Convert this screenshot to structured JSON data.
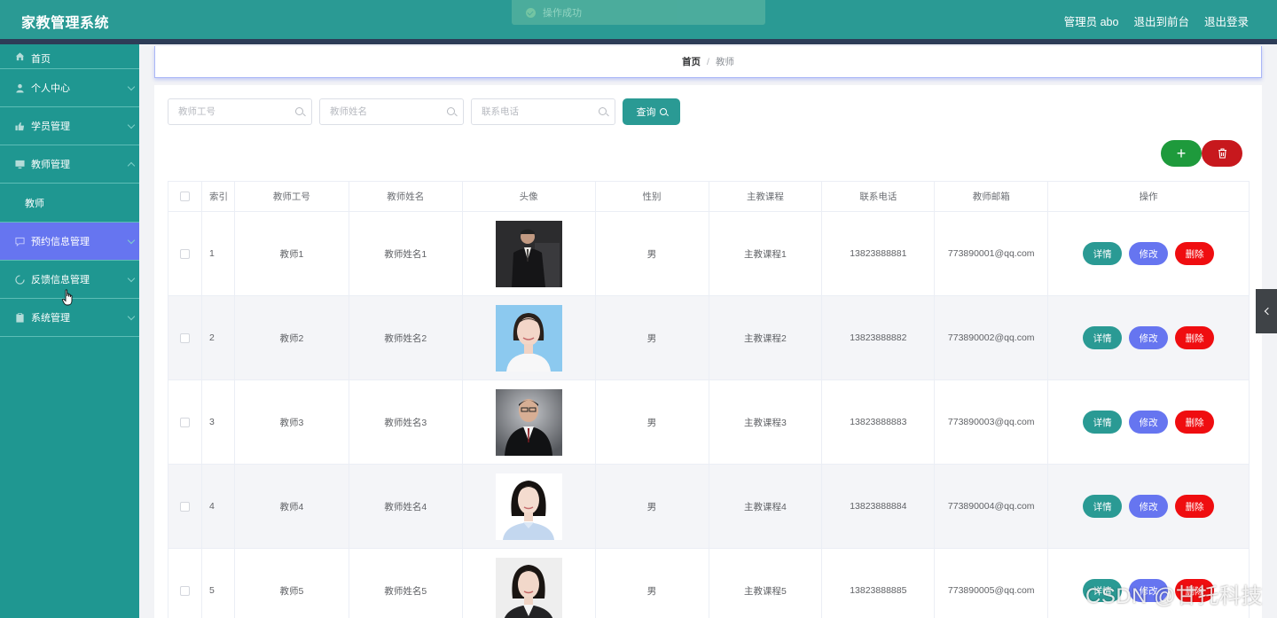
{
  "header": {
    "title": "家教管理系统",
    "admin_label": "管理员 abo",
    "back_front_label": "退出到前台",
    "logout_label": "退出登录",
    "accent_color": "#2a9a94"
  },
  "toast": {
    "message": "操作成功",
    "icon": "check-circle-icon"
  },
  "sidebar": {
    "items": [
      {
        "label": "首页",
        "icon": "home-icon"
      },
      {
        "label": "个人中心",
        "icon": "user-icon"
      },
      {
        "label": "学员管理",
        "icon": "thumb-icon"
      },
      {
        "label": "教师管理",
        "icon": "monitor-icon"
      },
      {
        "label": "教师",
        "icon": ""
      },
      {
        "label": "预约信息管理",
        "icon": "chat-icon"
      },
      {
        "label": "反馈信息管理",
        "icon": "loading-icon"
      },
      {
        "label": "系统管理",
        "icon": "clipboard-icon"
      }
    ],
    "active_color": "#6675f0"
  },
  "breadcrumb": {
    "home": "首页",
    "separator": "/",
    "current": "教师"
  },
  "search": {
    "teacher_no_placeholder": "教师工号",
    "teacher_name_placeholder": "教师姓名",
    "phone_placeholder": "联系电话",
    "query_label": "查询"
  },
  "toolbar": {
    "add_label": "+",
    "delete_icon": "trash-icon"
  },
  "table": {
    "headers": [
      "索引",
      "教师工号",
      "教师姓名",
      "头像",
      "性别",
      "主教课程",
      "联系电话",
      "教师邮箱",
      "操作"
    ],
    "rows": [
      {
        "index": "1",
        "no": "教师1",
        "name": "教师姓名1",
        "avatar": "photo-man-suit",
        "sex": "男",
        "course": "主教课程1",
        "phone": "13823888881",
        "email": "773890001@qq.com"
      },
      {
        "index": "2",
        "no": "教师2",
        "name": "教师姓名2",
        "avatar": "photo-woman-blue",
        "sex": "男",
        "course": "主教课程2",
        "phone": "13823888882",
        "email": "773890002@qq.com"
      },
      {
        "index": "3",
        "no": "教师3",
        "name": "教师姓名3",
        "avatar": "photo-man-glasses",
        "sex": "男",
        "course": "主教课程3",
        "phone": "13823888883",
        "email": "773890003@qq.com"
      },
      {
        "index": "4",
        "no": "教师4",
        "name": "教师姓名4",
        "avatar": "photo-woman-white",
        "sex": "男",
        "course": "主教课程4",
        "phone": "13823888884",
        "email": "773890004@qq.com"
      },
      {
        "index": "5",
        "no": "教师5",
        "name": "教师姓名5",
        "avatar": "photo-woman-suit",
        "sex": "男",
        "course": "主教课程5",
        "phone": "13823888885",
        "email": "773890005@qq.com"
      }
    ],
    "actions": {
      "detail": "详情",
      "edit": "修改",
      "delete": "删除"
    }
  },
  "watermark": "CSDN @甘托科技"
}
